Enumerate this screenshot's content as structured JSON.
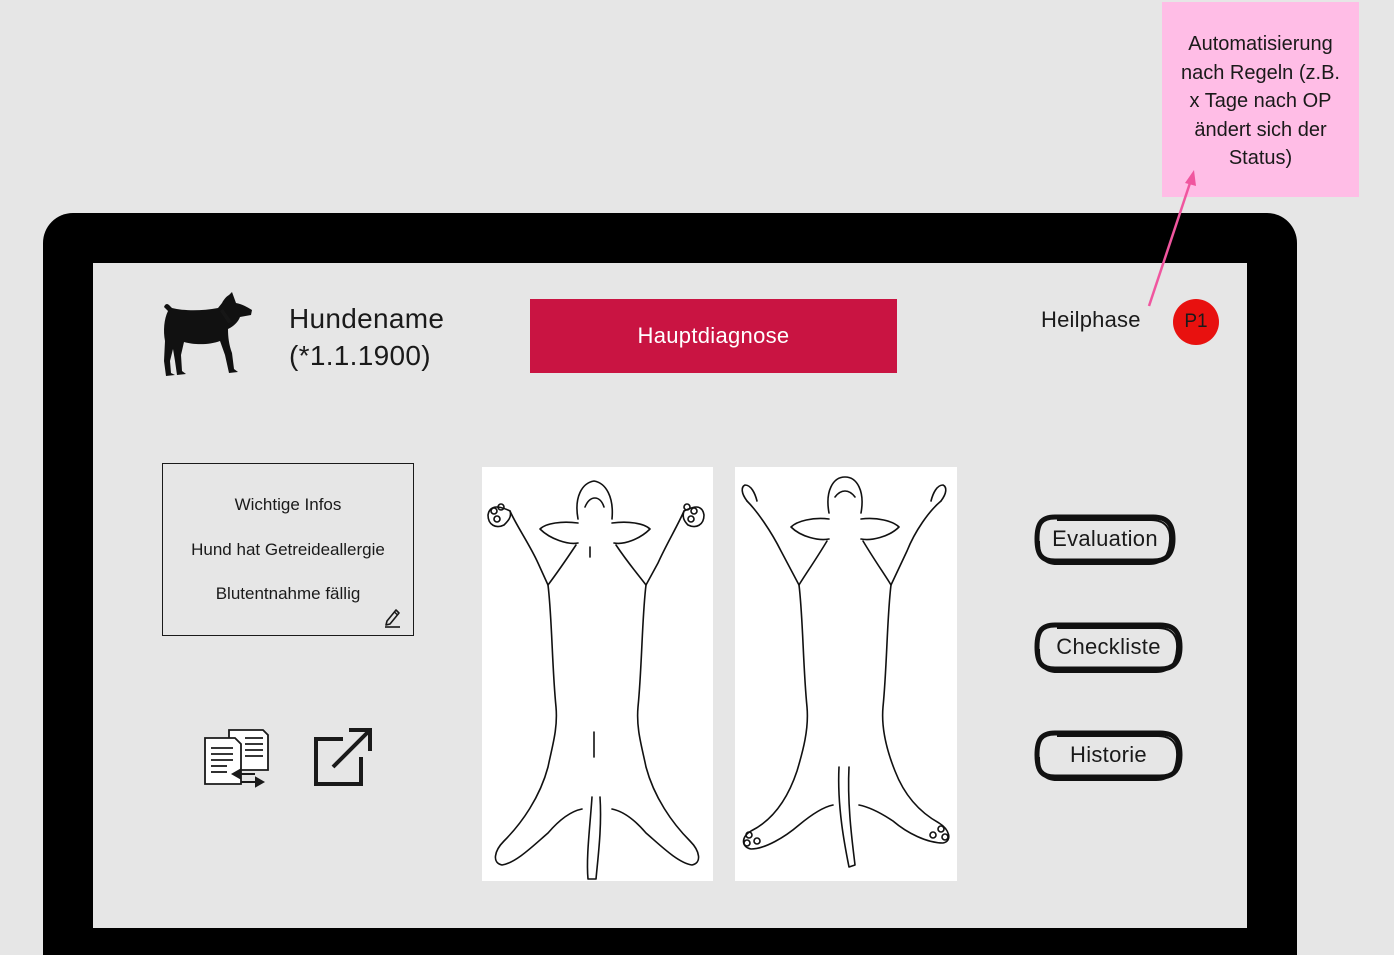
{
  "annotation": {
    "note_lines": [
      "Automatisierung",
      "nach Regeln (z.B.",
      "x Tage nach OP",
      "ändert sich der",
      "Status)"
    ],
    "note_color": "#ffbde6",
    "arrow_color": "#f0569f"
  },
  "header": {
    "patient_name": "Hundename",
    "patient_birth": "(*1.1.1900)",
    "diagnosis_label": "Hauptdiagnose",
    "diagnosis_color": "#c91442",
    "phase_label": "Heilphase",
    "phase_badge": "P1",
    "phase_badge_color": "#e8110f"
  },
  "info_box": {
    "title": "Wichtige Infos",
    "items": [
      "Hund hat Getreideallergie",
      "Blutentnahme fällig"
    ]
  },
  "icons": {
    "patient": "dog-icon",
    "edit": "pencil-icon",
    "compare": "compare-documents-icon",
    "open_external": "external-link-icon"
  },
  "body_views": [
    "dog-body-ventral-view",
    "dog-body-dorsal-view"
  ],
  "actions": {
    "evaluation": "Evaluation",
    "checklist": "Checkliste",
    "history": "Historie"
  }
}
